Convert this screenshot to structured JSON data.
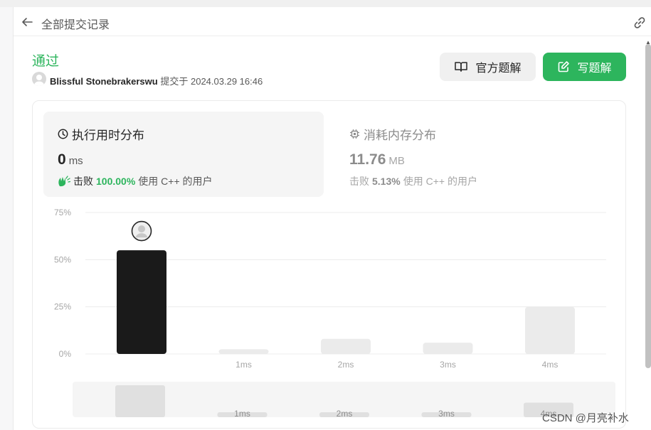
{
  "header": {
    "title": "全部提交记录"
  },
  "submission": {
    "status": "通过",
    "user": "Blissful Stonebrakerswu",
    "submitted_label": "提交于",
    "submitted_at": "2024.03.29 16:46"
  },
  "buttons": {
    "official_solution": "官方题解",
    "write_solution": "写题解"
  },
  "runtime": {
    "title": "执行用时分布",
    "value": "0",
    "unit": "ms",
    "beat_label": "击败",
    "beat_pct": "100.00%",
    "beat_suffix": "使用 C++ 的用户"
  },
  "memory": {
    "title": "消耗内存分布",
    "value": "11.76",
    "unit": "MB",
    "beat_label": "击败",
    "beat_pct": "5.13%",
    "beat_suffix": "使用 C++ 的用户"
  },
  "chart_data": {
    "type": "bar",
    "categories": [
      "",
      "1ms",
      "2ms",
      "3ms",
      "4ms"
    ],
    "values": [
      55,
      2.5,
      8,
      6,
      25
    ],
    "highlight_index": 0,
    "yticks": [
      "0%",
      "25%",
      "50%",
      "75%"
    ],
    "ylim": [
      0,
      75
    ],
    "grid": true,
    "colors": {
      "highlight": "#1a1a1a",
      "bar": "#ebebeb",
      "grid": "#ececec",
      "tick": "#a6a6a6"
    }
  },
  "minimap": {
    "categories": [
      "",
      "1ms",
      "2ms",
      "3ms",
      "4ms"
    ],
    "values": [
      55,
      2.5,
      8,
      6,
      25
    ]
  },
  "watermark": "CSDN @月亮补水"
}
